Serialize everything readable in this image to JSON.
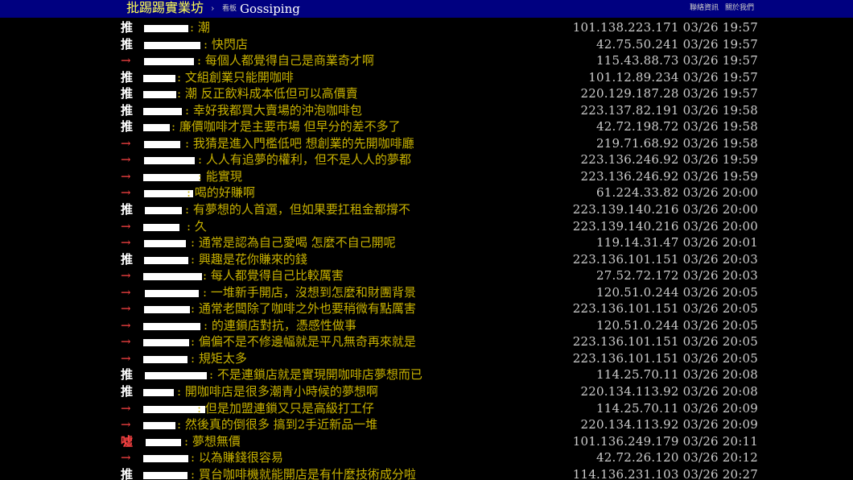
{
  "header": {
    "site_name": "批踢踢實業坊",
    "separator": "›",
    "board_label": "看板",
    "board_name": "Gossiping",
    "links": [
      "聯絡資訊",
      "關於我們"
    ]
  },
  "pushes": [
    {
      "tag": "推",
      "content": "潮",
      "ipdatetime": "101.138.223.171 03/26 19:57"
    },
    {
      "tag": "推",
      "content": "快閃店",
      "ipdatetime": "42.75.50.241 03/26 19:57"
    },
    {
      "tag": "→",
      "content": "每個人都覺得自己是商業奇才啊",
      "ipdatetime": "115.43.88.73 03/26 19:57"
    },
    {
      "tag": "推",
      "content": "文組創業只能開咖啡",
      "ipdatetime": "101.12.89.234 03/26 19:57"
    },
    {
      "tag": "推",
      "content": "潮 反正飲料成本低但可以高價賣",
      "ipdatetime": "220.129.187.28 03/26 19:57"
    },
    {
      "tag": "推",
      "content": "幸好我都買大賣場的沖泡咖啡包",
      "ipdatetime": "223.137.82.191 03/26 19:58"
    },
    {
      "tag": "推",
      "content": "廉價咖啡才是主要市場 但早分的差不多了",
      "ipdatetime": "42.72.198.72 03/26 19:58"
    },
    {
      "tag": "→",
      "content": "我猜是進入門檻低吧 想創業的先開咖啡廳",
      "ipdatetime": "219.71.68.92 03/26 19:58"
    },
    {
      "tag": "→",
      "content": "人人有追夢的權利，但不是人人的夢都",
      "ipdatetime": "223.136.246.92 03/26 19:59"
    },
    {
      "tag": "→",
      "content": "能實現",
      "ipdatetime": "223.136.246.92 03/26 19:59"
    },
    {
      "tag": "→",
      "content": "喝的好賺啊",
      "ipdatetime": "61.224.33.82 03/26 20:00"
    },
    {
      "tag": "推",
      "content": "有夢想的人首選，但如果要扛租金都撐不",
      "ipdatetime": "223.139.140.216 03/26 20:00"
    },
    {
      "tag": "→",
      "content": "久",
      "ipdatetime": "223.139.140.216 03/26 20:00"
    },
    {
      "tag": "→",
      "content": "通常是認為自己愛喝 怎麼不自己開呢",
      "ipdatetime": "119.14.31.47 03/26 20:01"
    },
    {
      "tag": "推",
      "content": "興趣是花你賺來的錢",
      "ipdatetime": "223.136.101.151 03/26 20:03"
    },
    {
      "tag": "→",
      "content": "每人都覺得自己比較厲害",
      "ipdatetime": "27.52.72.172 03/26 20:03"
    },
    {
      "tag": "→",
      "content": "一堆新手開店，沒想到怎麼和財團背景",
      "ipdatetime": "120.51.0.244 03/26 20:05"
    },
    {
      "tag": "→",
      "content": "通常老闆除了咖啡之外也要稍微有點厲害",
      "ipdatetime": "223.136.101.151 03/26 20:05"
    },
    {
      "tag": "→",
      "content": "的連鎖店對抗，憑感性做事",
      "ipdatetime": "120.51.0.244 03/26 20:05"
    },
    {
      "tag": "→",
      "content": "偏偏不是不修邊幅就是平凡無奇再來就是",
      "ipdatetime": "223.136.101.151 03/26 20:05"
    },
    {
      "tag": "→",
      "content": "規矩太多",
      "ipdatetime": "223.136.101.151 03/26 20:05"
    },
    {
      "tag": "推",
      "content": "不是連鎖店就是實現開咖啡店夢想而已",
      "ipdatetime": "114.25.70.11 03/26 20:08"
    },
    {
      "tag": "推",
      "content": "開咖啡店是很多潮青小時候的夢想啊",
      "ipdatetime": "220.134.113.92 03/26 20:08"
    },
    {
      "tag": "→",
      "content": "但是加盟連鎖又只是高級打工仔",
      "ipdatetime": "114.25.70.11 03/26 20:09"
    },
    {
      "tag": "→",
      "content": "然後真的倒很多  搞到2手近新品一堆",
      "ipdatetime": "220.134.113.92 03/26 20:09"
    },
    {
      "tag": "噓",
      "content": "夢想無價",
      "ipdatetime": "101.136.249.179 03/26 20:11"
    },
    {
      "tag": "→",
      "content": "以為賺錢很容易",
      "ipdatetime": "42.72.26.120 03/26 20:12"
    },
    {
      "tag": "推",
      "content": "買台咖啡機就能開店是有什麼技術成分啦",
      "ipdatetime": "114.136.231.103 03/26 20:27"
    }
  ],
  "colors": {
    "header_bg": "#000080",
    "site_name": "#ffff55",
    "push_content": "#c8b200",
    "arrow_tag": "#ff4444",
    "boo_tag": "#ff4444",
    "push_tag": "#ffffff"
  }
}
